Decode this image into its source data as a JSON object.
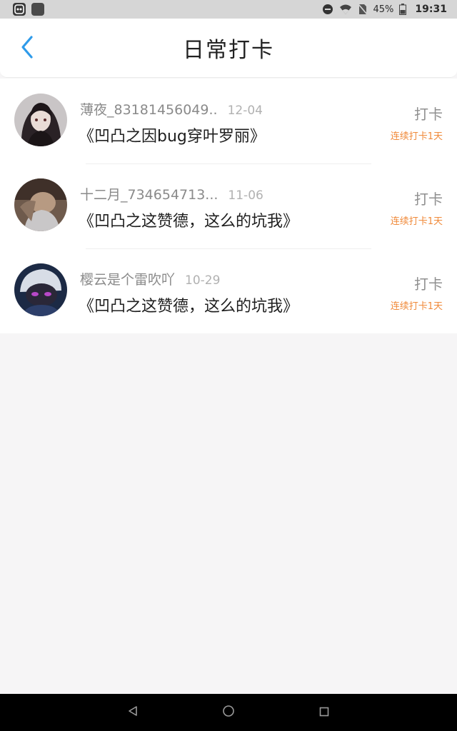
{
  "status_bar": {
    "battery_percent": "45%",
    "time": "19:31",
    "icons": [
      "app-icon",
      "square-app-icon",
      "do-not-disturb-icon",
      "wifi-icon",
      "no-sim-icon",
      "battery-icon"
    ]
  },
  "header": {
    "title": "日常打卡",
    "back_icon": "chevron-left-icon"
  },
  "items": [
    {
      "username": "薄夜_83181456049..",
      "date": "12-04",
      "book": "《凹凸之因bug穿叶罗丽》",
      "action": "打卡",
      "streak": "连续打卡1天"
    },
    {
      "username": "十二月_734654713...",
      "date": "11-06",
      "book": "《凹凸之这赞德，这么的坑我》",
      "action": "打卡",
      "streak": "连续打卡1天"
    },
    {
      "username": "樱云是个雷吹吖",
      "date": "10-29",
      "book": "《凹凸之这赞德，这么的坑我》",
      "action": "打卡",
      "streak": "连续打卡1天"
    }
  ],
  "colors": {
    "accent_blue": "#2f9bea",
    "streak_orange": "#f08a3a"
  }
}
